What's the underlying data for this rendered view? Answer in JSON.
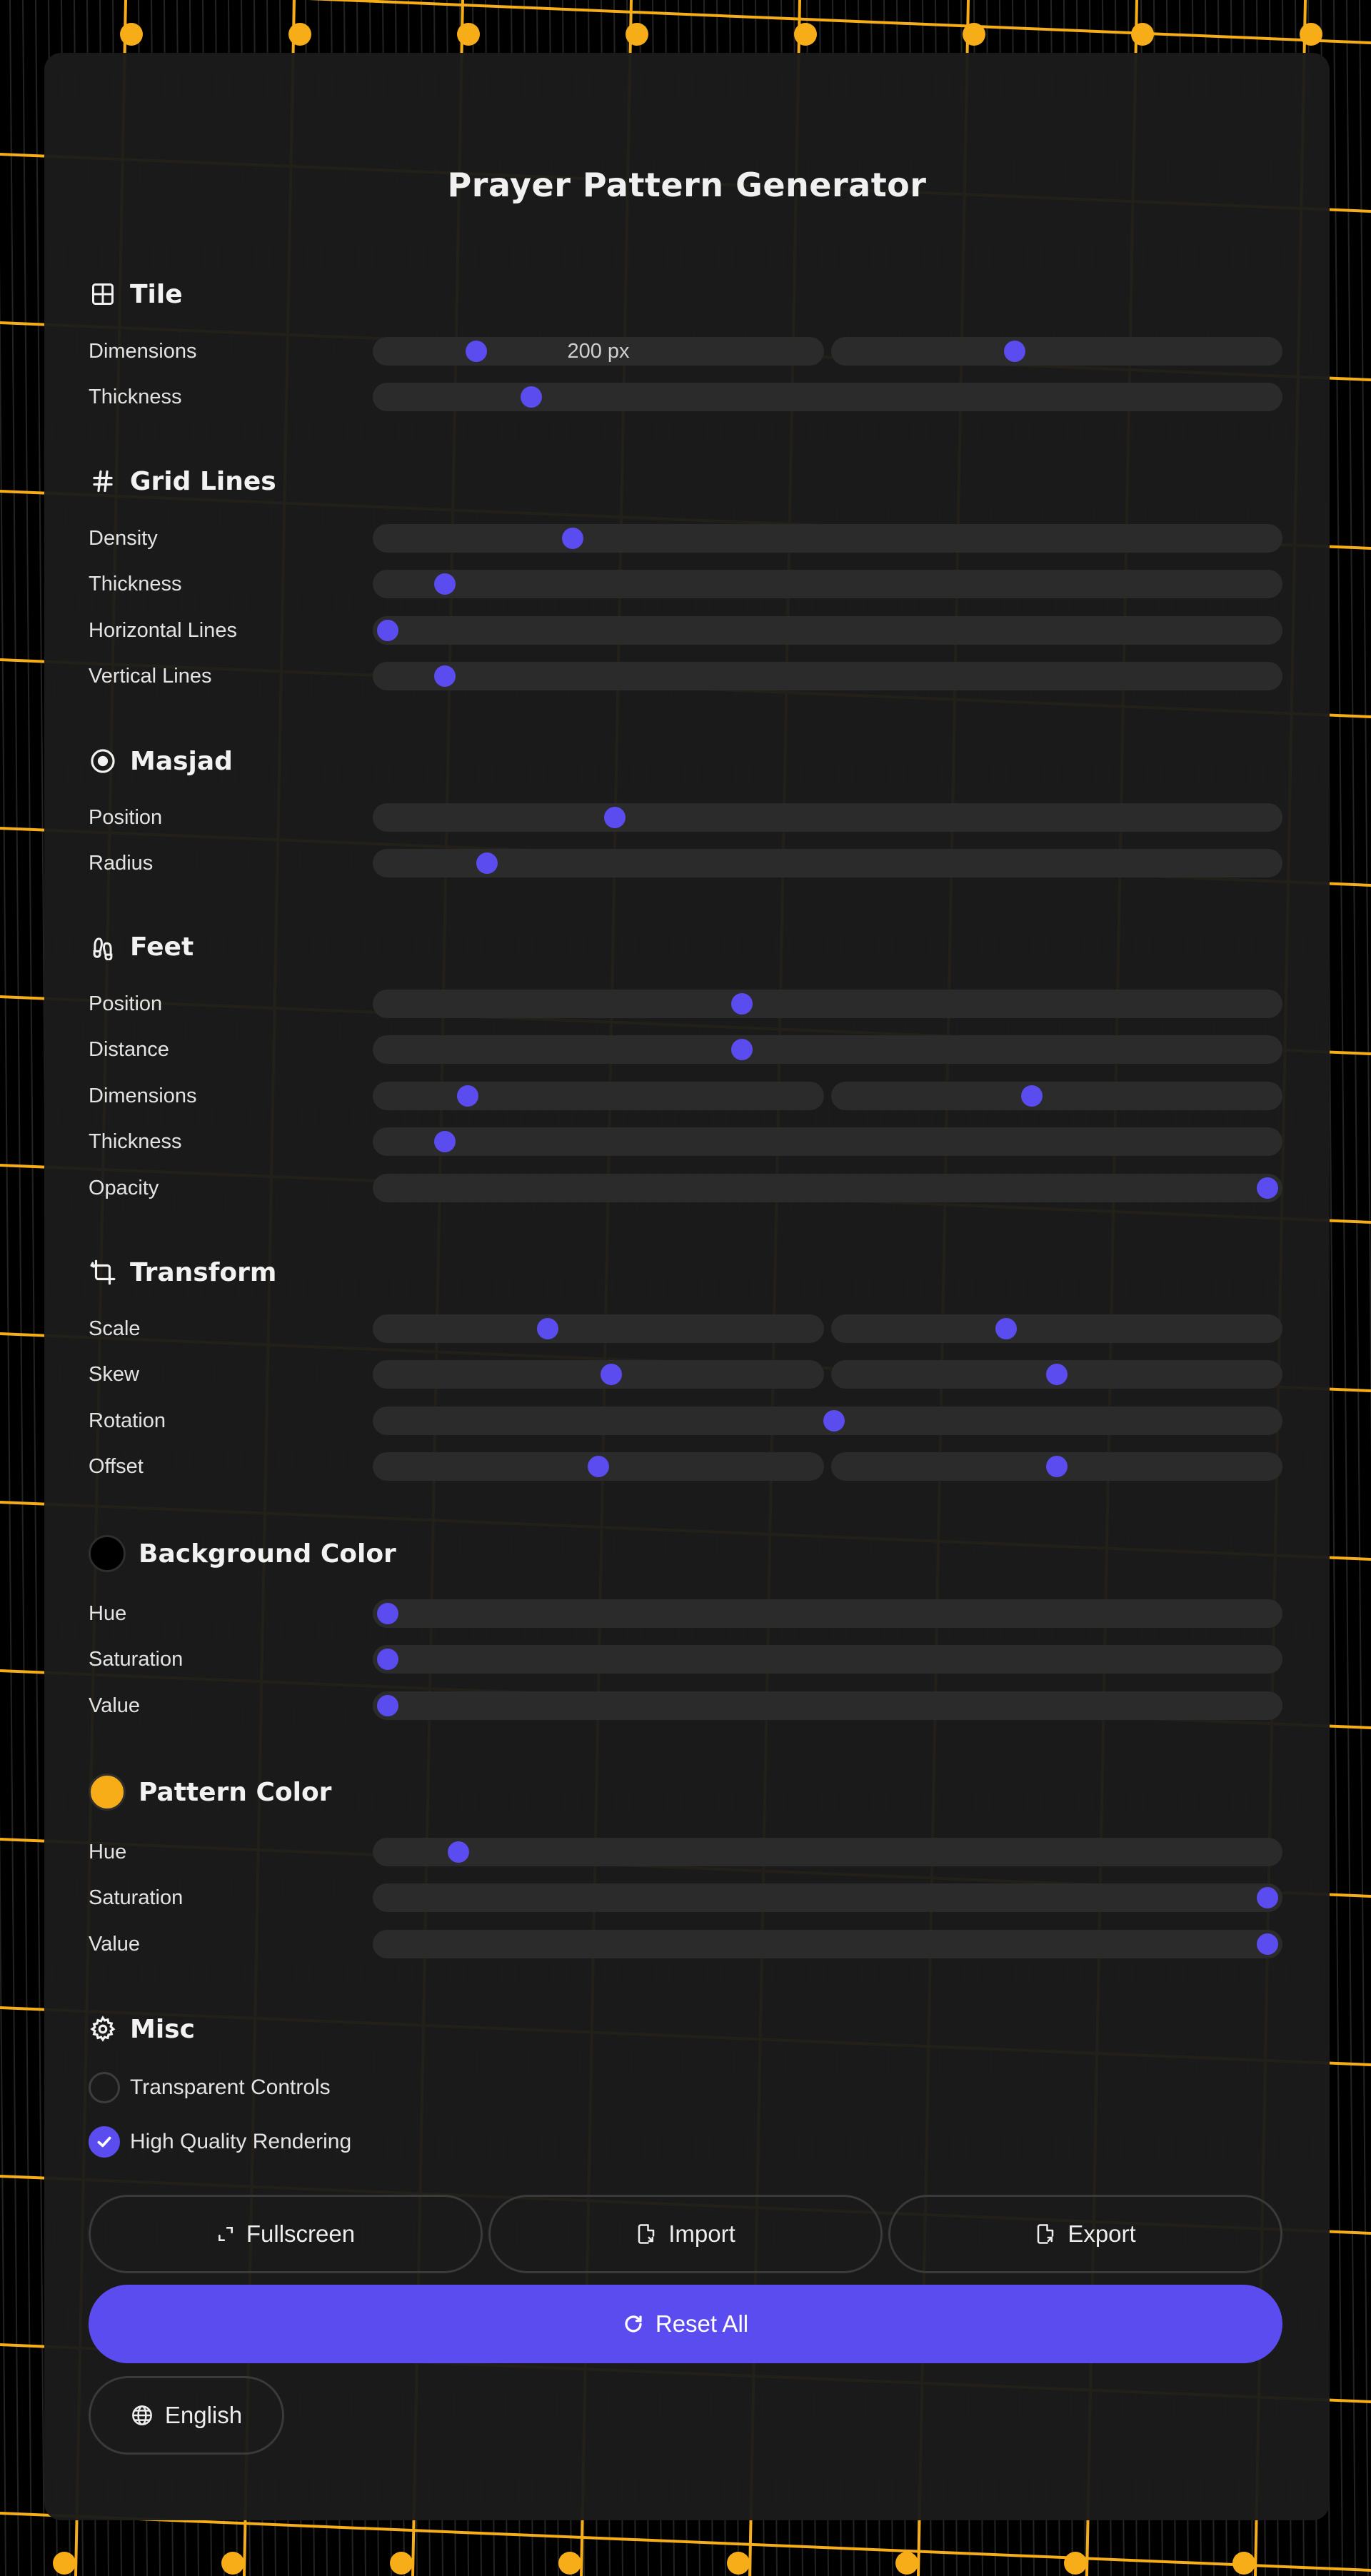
{
  "app": {
    "title": "Prayer Pattern Generator"
  },
  "colors": {
    "accent": "#5b4cf0",
    "panel": "#1b1b1b",
    "track": "#2b2b2b",
    "pattern": "#f6ad17",
    "background": "#000000"
  },
  "sections": {
    "tile": {
      "title": "Tile",
      "icon": "grid-square-icon",
      "dimensions": {
        "label": "Dimensions",
        "value_text": "200 px",
        "values": [
          0.21,
          0.4
        ]
      },
      "thickness": {
        "label": "Thickness",
        "value": 0.163
      }
    },
    "grid_lines": {
      "title": "Grid Lines",
      "icon": "hash-icon",
      "density": {
        "label": "Density",
        "value": 0.21
      },
      "thickness": {
        "label": "Thickness",
        "value": 0.065
      },
      "horizontal": {
        "label": "Horizontal Lines",
        "value": 0.0
      },
      "vertical": {
        "label": "Vertical Lines",
        "value": 0.065
      }
    },
    "masjad": {
      "title": "Masjad",
      "icon": "target-icon",
      "position": {
        "label": "Position",
        "value": 0.258
      },
      "radius": {
        "label": "Radius",
        "value": 0.113
      }
    },
    "feet": {
      "title": "Feet",
      "icon": "footprints-icon",
      "position": {
        "label": "Position",
        "value": 0.403
      },
      "distance": {
        "label": "Distance",
        "value": 0.403
      },
      "dimensions": {
        "label": "Dimensions",
        "values": [
          0.19,
          0.44
        ]
      },
      "thickness": {
        "label": "Thickness",
        "value": 0.065
      },
      "opacity": {
        "label": "Opacity",
        "value": 1.0
      }
    },
    "transform": {
      "title": "Transform",
      "icon": "crop-transform-icon",
      "scale": {
        "label": "Scale",
        "values": [
          0.38,
          0.38
        ]
      },
      "skew": {
        "label": "Skew",
        "values": [
          0.53,
          0.5
        ]
      },
      "rotation": {
        "label": "Rotation",
        "value": 0.507
      },
      "offset": {
        "label": "Offset",
        "values": [
          0.5,
          0.5
        ]
      }
    },
    "background_color": {
      "title": "Background Color",
      "swatch": "#000000",
      "hue": {
        "label": "Hue",
        "value": 0.0
      },
      "saturation": {
        "label": "Saturation",
        "value": 0.0
      },
      "value": {
        "label": "Value",
        "value": 0.0
      }
    },
    "pattern_color": {
      "title": "Pattern Color",
      "swatch": "#f6ad17",
      "hue": {
        "label": "Hue",
        "value": 0.08
      },
      "saturation": {
        "label": "Saturation",
        "value": 1.0
      },
      "value": {
        "label": "Value",
        "value": 1.0
      }
    },
    "misc": {
      "title": "Misc",
      "icon": "gear-icon",
      "transparent_controls": {
        "label": "Transparent Controls",
        "checked": false
      },
      "high_quality": {
        "label": "High Quality Rendering",
        "checked": true
      }
    }
  },
  "buttons": {
    "fullscreen": {
      "label": "Fullscreen",
      "icon": "expand-icon"
    },
    "import": {
      "label": "Import",
      "icon": "file-import-icon"
    },
    "export": {
      "label": "Export",
      "icon": "file-export-icon"
    },
    "reset": {
      "label": "Reset All",
      "icon": "refresh-icon"
    },
    "language": {
      "label": "English",
      "icon": "globe-icon"
    }
  }
}
